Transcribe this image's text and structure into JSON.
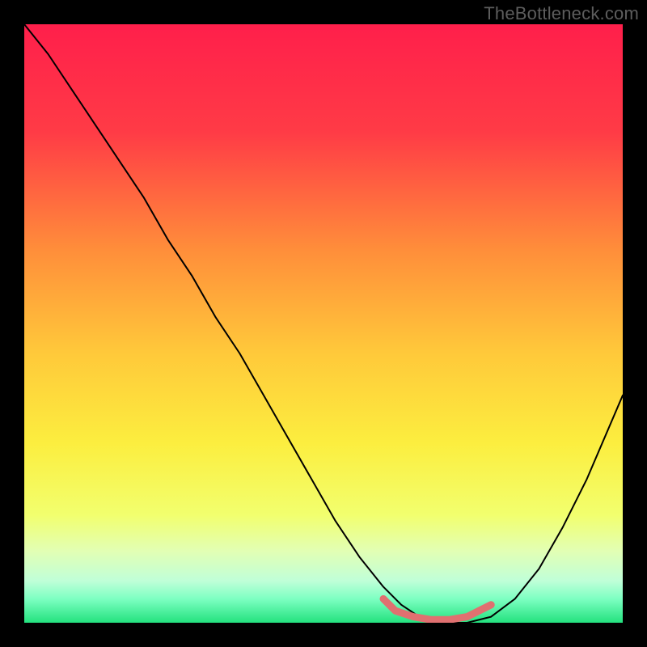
{
  "watermark": "TheBottleneck.com",
  "chart_data": {
    "type": "line",
    "title": "",
    "xlabel": "",
    "ylabel": "",
    "xlim": [
      0,
      100
    ],
    "ylim": [
      0,
      100
    ],
    "background_gradient_stops": [
      {
        "offset": 0,
        "color": "#ff1f4b"
      },
      {
        "offset": 18,
        "color": "#ff3b46"
      },
      {
        "offset": 38,
        "color": "#ff8f3a"
      },
      {
        "offset": 55,
        "color": "#ffc93a"
      },
      {
        "offset": 70,
        "color": "#fcee3f"
      },
      {
        "offset": 82,
        "color": "#f2ff6e"
      },
      {
        "offset": 88,
        "color": "#e2ffb4"
      },
      {
        "offset": 93,
        "color": "#c0ffd8"
      },
      {
        "offset": 96,
        "color": "#7dffc2"
      },
      {
        "offset": 100,
        "color": "#23e27e"
      }
    ],
    "series": [
      {
        "name": "bottleneck-curve",
        "color": "#000000",
        "width": 2,
        "x": [
          0,
          4,
          8,
          12,
          16,
          20,
          24,
          28,
          32,
          36,
          40,
          44,
          48,
          52,
          56,
          60,
          63,
          66,
          70,
          74,
          78,
          82,
          86,
          90,
          94,
          100
        ],
        "values": [
          100,
          95,
          89,
          83,
          77,
          71,
          64,
          58,
          51,
          45,
          38,
          31,
          24,
          17,
          11,
          6,
          3,
          1,
          0,
          0,
          1,
          4,
          9,
          16,
          24,
          38
        ]
      }
    ],
    "highlight_segment": {
      "name": "optimal-range",
      "color": "#e07070",
      "width": 9,
      "x": [
        60,
        62,
        65,
        68,
        71,
        74,
        76,
        78
      ],
      "values": [
        4,
        2,
        1,
        0.5,
        0.5,
        1,
        2,
        3
      ]
    }
  }
}
